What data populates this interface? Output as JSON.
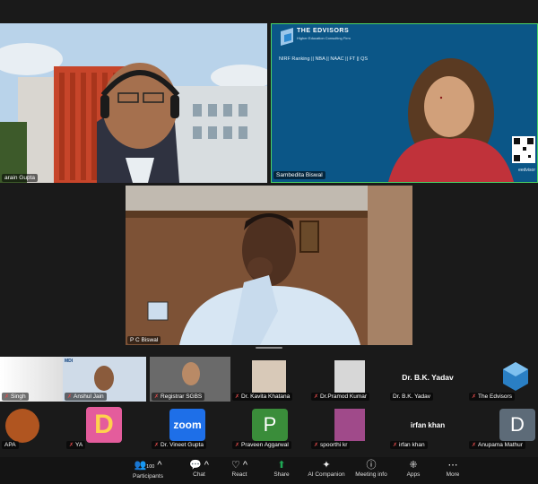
{
  "tiles": {
    "main1_name": "arain Gupta",
    "main2_name": "Sambedita Biswal",
    "main3_name": "P C Biswal",
    "edvisors_brand": "THE EDVISORS",
    "edvisors_tag": "Higher Education Consulting Firm",
    "edvisors_line": "NIRF Ranking || NBA || NAAC || FT || QS",
    "qr_caption": "eedvisor"
  },
  "row1": [
    {
      "name": "Singh"
    },
    {
      "name": "Anshul Jain"
    },
    {
      "name": "Registrar SGBS"
    },
    {
      "name": "Dr. Kavita Khatana"
    },
    {
      "name": "Dr.Pramod Kumar"
    },
    {
      "name": "Dr. B.K. Yadav",
      "center_text": "Dr. B.K. Yadav"
    },
    {
      "name": "The Edvisors"
    }
  ],
  "row2": [
    {
      "name": "APA"
    },
    {
      "name": "YA",
      "center_text": "D"
    },
    {
      "name": "Dr. Vineet Gupta",
      "center_text": "zoom"
    },
    {
      "name": "Praveen Aggarwal",
      "center_text": "P"
    },
    {
      "name": "spoorthi kr"
    },
    {
      "name": "irfan khan",
      "center_text": "irfan khan"
    },
    {
      "name": "Anupama Mathur",
      "center_text": "D"
    }
  ],
  "toolbar": {
    "participants_label": "Participants",
    "participants_count": "100",
    "chat_label": "Chat",
    "react_label": "React",
    "share_label": "Share",
    "ai_label": "AI Companion",
    "meeting_info_label": "Meeting info",
    "apps_label": "Apps",
    "more_label": "More"
  },
  "colors": {
    "active_speaker_border": "#4ad467",
    "share_green": "#1fa855",
    "muted_red": "#e34c4c"
  }
}
